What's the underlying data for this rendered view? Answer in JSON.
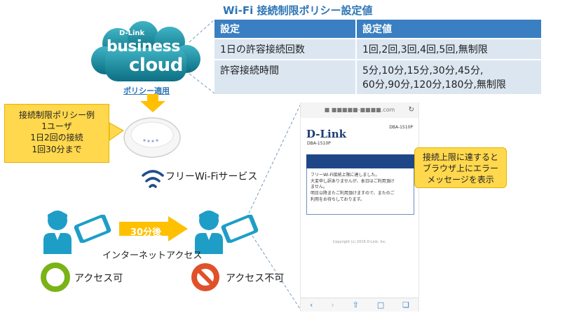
{
  "table": {
    "title": "Wi-Fi 接続制限ポリシー設定値",
    "headers": [
      "設定",
      "設定値"
    ],
    "rows": [
      {
        "label": "1日の許容接続回数",
        "value_lines": [
          "1回,2回,3回,4回,5回,無制限"
        ]
      },
      {
        "label": "許容接続時間",
        "value_lines": [
          "5分,10分,15分,30分,45分,",
          "60分,90分,120分,180分,無制限"
        ]
      }
    ]
  },
  "cloud": {
    "brand": "D-Link",
    "line1": "business",
    "line2": "cloud",
    "apply_label": "ポリシー適用"
  },
  "callout_left": {
    "lines": [
      "接続制限ポリシー例",
      "1ユーザ",
      "1日2回の接続",
      "1回30分まで"
    ]
  },
  "callout_right": {
    "lines": [
      "接続上限に達すると",
      "ブラウザ上にエラー",
      "メッセージを表示"
    ]
  },
  "labels": {
    "wifi_service": "フリーWi-Fiサービス",
    "after": "30分後",
    "internet_access": "インターネットアクセス",
    "access_ok": "アクセス可",
    "access_ng": "アクセス不可"
  },
  "phone": {
    "url": "■ ■■■■■-■■■■.com",
    "logo": "D-Link",
    "model_right": "DBA-1510P",
    "model_left": "DBA-1510P",
    "message_lines": [
      "フリーWi-Fi接続上限に達しました。",
      "大変申し訳ありませんが、本日はご利用頂け",
      "ません。",
      "明日以降またご利用頂けますので、またのご",
      "利用をお待ちしております。"
    ],
    "copyright": "Copyright (c) 2016 D-Link, Inc.",
    "toolbar_icons": [
      "back-icon",
      "forward-icon",
      "share-icon",
      "bookmarks-icon",
      "tabs-icon"
    ]
  },
  "colors": {
    "accent_blue": "#3a7fc1",
    "callout_yellow": "#ffd84d",
    "cloud_teal": "#1c8aa0",
    "ok_green": "#7ab317",
    "ng_red": "#e0502a",
    "person_teal": "#1e9ec7"
  }
}
